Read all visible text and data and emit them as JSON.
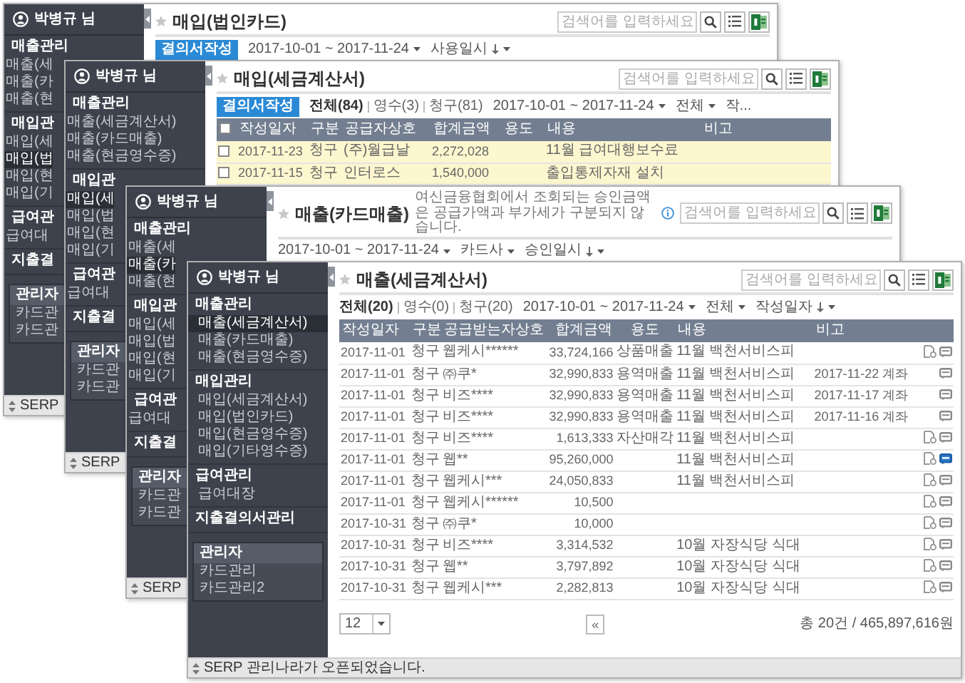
{
  "windows": [
    {
      "title": "매입(법인카드)",
      "sidebar": {
        "user": "박병규 님",
        "sections": [
          {
            "heading": "매출관리",
            "items": [
              {
                "label": "매출(세",
                "selected": false
              },
              {
                "label": "매출(카",
                "selected": false
              },
              {
                "label": "매출(현",
                "selected": false
              }
            ]
          },
          {
            "heading": "매입관",
            "items": [
              {
                "label": "매입(세",
                "selected": false
              },
              {
                "label": "매입(법",
                "selected": true
              },
              {
                "label": "매입(현",
                "selected": false
              },
              {
                "label": "매입(기",
                "selected": false
              }
            ]
          },
          {
            "heading": "급여관",
            "items": [
              {
                "label": "급여대",
                "selected": false
              }
            ]
          },
          {
            "heading": "지출결"
          }
        ],
        "admin": {
          "heading": "관리자",
          "items": [
            "카드관",
            "카드관"
          ]
        }
      },
      "search": {
        "placeholder": "검색어를 입력하세요"
      },
      "toolbar": [
        {
          "kind": "action",
          "label": "결의서작성"
        },
        {
          "kind": "dropdown",
          "label": "2017-10-01 ~ 2017-11-24"
        },
        {
          "kind": "sort",
          "label": "사용일시"
        }
      ],
      "status": "SERP"
    },
    {
      "title": "매입(세금계산서)",
      "sidebar": {
        "user": "박병규 님",
        "sections": [
          {
            "heading": "매출관리",
            "items": [
              {
                "label": "매출(세금계산서)",
                "selected": false
              },
              {
                "label": "매출(카드매출)",
                "selected": false
              },
              {
                "label": "매출(현금영수증)",
                "selected": false
              }
            ]
          },
          {
            "heading": "매입관",
            "items": [
              {
                "label": "매입(세",
                "selected": true
              },
              {
                "label": "매입(법",
                "selected": false
              },
              {
                "label": "매입(현",
                "selected": false
              },
              {
                "label": "매입(기",
                "selected": false
              }
            ]
          },
          {
            "heading": "급여관",
            "items": [
              {
                "label": "급여대",
                "selected": false
              }
            ]
          },
          {
            "heading": "지출결"
          }
        ],
        "admin": {
          "heading": "관리자",
          "items": [
            "카드관",
            "카드관"
          ]
        }
      },
      "search": {
        "placeholder": "검색어를 입력하세요"
      },
      "toolbar": [
        {
          "kind": "action",
          "label": "결의서작성"
        },
        {
          "kind": "filter",
          "options": [
            {
              "label": "전체(84)",
              "selected": true
            },
            {
              "label": "영수(3)",
              "selected": false
            },
            {
              "label": "청구(81)",
              "selected": false
            }
          ]
        },
        {
          "kind": "dropdown",
          "label": "2017-10-01 ~ 2017-11-24"
        },
        {
          "kind": "dropdown",
          "label": "전체"
        },
        {
          "kind": "text",
          "label": "작..."
        }
      ],
      "table": {
        "kind": "purchase",
        "select_all": false,
        "columns": [
          "작성일자",
          "구분",
          "공급자상호",
          "합계금액",
          "용도",
          "내용",
          "비고"
        ],
        "rows": [
          {
            "checked": false,
            "highlighted": true,
            "cells": [
              "2017-11-23",
              "청구",
              "(주)월급날",
              "2,272,028",
              null,
              "11월 급여대행보수료",
              null
            ]
          },
          {
            "checked": false,
            "highlighted": true,
            "cells": [
              "2017-11-15",
              "청구",
              "인터로스",
              "1,540,000",
              null,
              "출입통제자재 설치",
              null
            ]
          }
        ]
      },
      "status": "SERP"
    },
    {
      "title": "매출(카드매출)",
      "note": "여신금융협회에서 조회되는 승인금액은 공급가액과 부가세가 구분되지 않습니다.",
      "sidebar": {
        "user": "박병규 님",
        "sections": [
          {
            "heading": "매출관리",
            "items": [
              {
                "label": "매출(세",
                "selected": false
              },
              {
                "label": "매출(카",
                "selected": true
              },
              {
                "label": "매출(현",
                "selected": false
              }
            ]
          },
          {
            "heading": "매입관",
            "items": [
              {
                "label": "매입(세",
                "selected": false
              },
              {
                "label": "매입(법",
                "selected": false
              },
              {
                "label": "매입(현",
                "selected": false
              },
              {
                "label": "매입(기",
                "selected": false
              }
            ]
          },
          {
            "heading": "급여관",
            "items": [
              {
                "label": "급여대",
                "selected": false
              }
            ]
          },
          {
            "heading": "지출결"
          }
        ],
        "admin": {
          "heading": "관리자",
          "items": [
            "카드관",
            "카드관"
          ]
        }
      },
      "search": {
        "placeholder": "검색어를 입력하세요"
      },
      "toolbar": [
        {
          "kind": "dropdown",
          "label": "2017-10-01 ~ 2017-11-24"
        },
        {
          "kind": "dropdown",
          "label": "카드사"
        },
        {
          "kind": "sort",
          "label": "승인일시"
        }
      ],
      "status": "SERP"
    },
    {
      "title": "매출(세금계산서)",
      "sidebar": {
        "user": "박병규 님",
        "sections": [
          {
            "heading": "매출관리",
            "items": [
              {
                "label": "매출(세금계산서)",
                "selected": true
              },
              {
                "label": "매출(카드매출)",
                "selected": false
              },
              {
                "label": "매출(현금영수증)",
                "selected": false
              }
            ]
          },
          {
            "heading": "매입관리",
            "items": [
              {
                "label": "매입(세금계산서)",
                "selected": false
              },
              {
                "label": "매입(법인카드)",
                "selected": false
              },
              {
                "label": "매입(현금영수증)",
                "selected": false
              },
              {
                "label": "매입(기타영수증)",
                "selected": false
              }
            ]
          },
          {
            "heading": "급여관리",
            "items": [
              {
                "label": "급여대장",
                "selected": false
              }
            ]
          },
          {
            "heading": "지출결의서관리"
          }
        ],
        "admin": {
          "heading": "관리자",
          "items": [
            "카드관리",
            "카드관리2"
          ]
        }
      },
      "search": {
        "placeholder": "검색어를 입력하세요"
      },
      "toolbar": [
        {
          "kind": "filter",
          "options": [
            {
              "label": "전체(20)",
              "selected": true
            },
            {
              "label": "영수(0)",
              "selected": false
            },
            {
              "label": "청구(20)",
              "selected": false
            }
          ]
        },
        {
          "kind": "dropdown",
          "label": "2017-10-01 ~ 2017-11-24"
        },
        {
          "kind": "dropdown",
          "label": "전체"
        },
        {
          "kind": "sort",
          "label": "작성일자"
        }
      ],
      "table": {
        "kind": "sales",
        "columns": [
          "작성일자",
          "구분",
          "공급받는자상호",
          "합계금액",
          "용도",
          "내용",
          "비고"
        ],
        "rows": [
          {
            "attachment": true,
            "memo_selected": false,
            "cells": [
              "2017-11-01",
              "청구",
              "웹케시******",
              "33,724,166",
              "상품매출",
              "11월 백천서비스피",
              null
            ]
          },
          {
            "attachment": false,
            "memo_selected": false,
            "cells": [
              "2017-11-01",
              "청구",
              "㈜쿠*",
              "32,990,833",
              "용역매출",
              "11월 백천서비스피",
              "2017-11-22 계좌"
            ]
          },
          {
            "attachment": false,
            "memo_selected": false,
            "cells": [
              "2017-11-01",
              "청구",
              "비즈****",
              "32,990,833",
              "용역매출",
              "11월 백천서비스피",
              "2017-11-17 계좌"
            ]
          },
          {
            "attachment": false,
            "memo_selected": false,
            "cells": [
              "2017-11-01",
              "청구",
              "비즈****",
              "32,990,833",
              "용역매출",
              "11월 백천서비스피",
              "2017-11-16 계좌"
            ]
          },
          {
            "attachment": true,
            "memo_selected": false,
            "cells": [
              "2017-11-01",
              "청구",
              "비즈****",
              "1,613,333",
              "자산매각",
              "11월 백천서비스피",
              null
            ]
          },
          {
            "attachment": true,
            "memo_selected": true,
            "cells": [
              "2017-11-01",
              "청구",
              "웹**",
              "95,260,000",
              null,
              "11월 백천서비스피",
              null
            ]
          },
          {
            "attachment": true,
            "memo_selected": false,
            "cells": [
              "2017-11-01",
              "청구",
              "웹케시***",
              "24,050,833",
              null,
              "11월 백천서비스피",
              null
            ]
          },
          {
            "attachment": true,
            "memo_selected": false,
            "cells": [
              "2017-11-01",
              "청구",
              "웹케시******",
              "10,500",
              null,
              null,
              null
            ]
          },
          {
            "attachment": true,
            "memo_selected": false,
            "cells": [
              "2017-10-31",
              "청구",
              "㈜쿠*",
              "10,000",
              null,
              null,
              null
            ]
          },
          {
            "attachment": true,
            "memo_selected": false,
            "cells": [
              "2017-10-31",
              "청구",
              "비즈****",
              "3,314,532",
              null,
              "10월 자장식당 식대",
              null
            ]
          },
          {
            "attachment": true,
            "memo_selected": false,
            "cells": [
              "2017-10-31",
              "청구",
              "웹**",
              "3,797,892",
              null,
              "10월 자장식당 식대",
              null
            ]
          },
          {
            "attachment": true,
            "memo_selected": false,
            "cells": [
              "2017-10-31",
              "청구",
              "웹케시***",
              "2,282,813",
              null,
              "10월 자장식당 식대",
              null
            ]
          }
        ]
      },
      "footer": {
        "page_size": "12",
        "pager": "«",
        "total": "총 20건 / 465,897,616원"
      },
      "status": "SERP 관리나라가 오픈되었습니다."
    }
  ]
}
